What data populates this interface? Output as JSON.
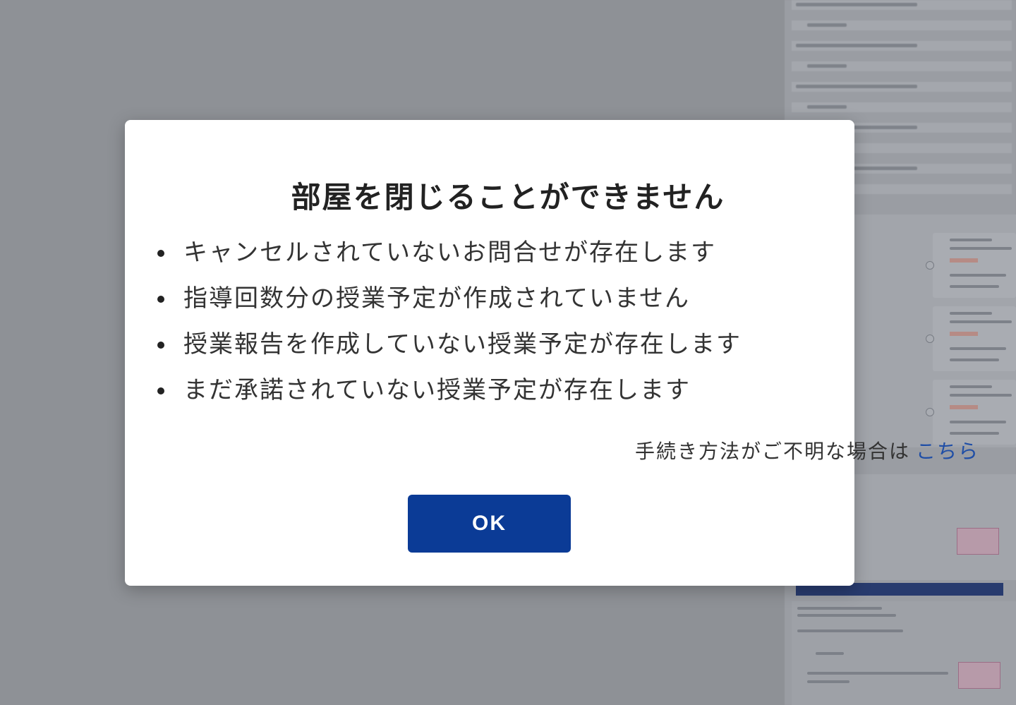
{
  "dialog": {
    "title": "部屋を閉じることができません",
    "reasons": [
      "キャンセルされていないお問合せが存在します",
      "指導回数分の授業予定が作成されていません",
      "授業報告を作成していない授業予定が存在します",
      "まだ承諾されていない授業予定が存在します"
    ],
    "help_text": "手続き方法がご不明な場合は",
    "help_link": "こちら",
    "ok_label": "OK"
  },
  "colors": {
    "overlay": "#8e9196",
    "primary_button": "#0b3b96",
    "link": "#1f4ea6"
  }
}
